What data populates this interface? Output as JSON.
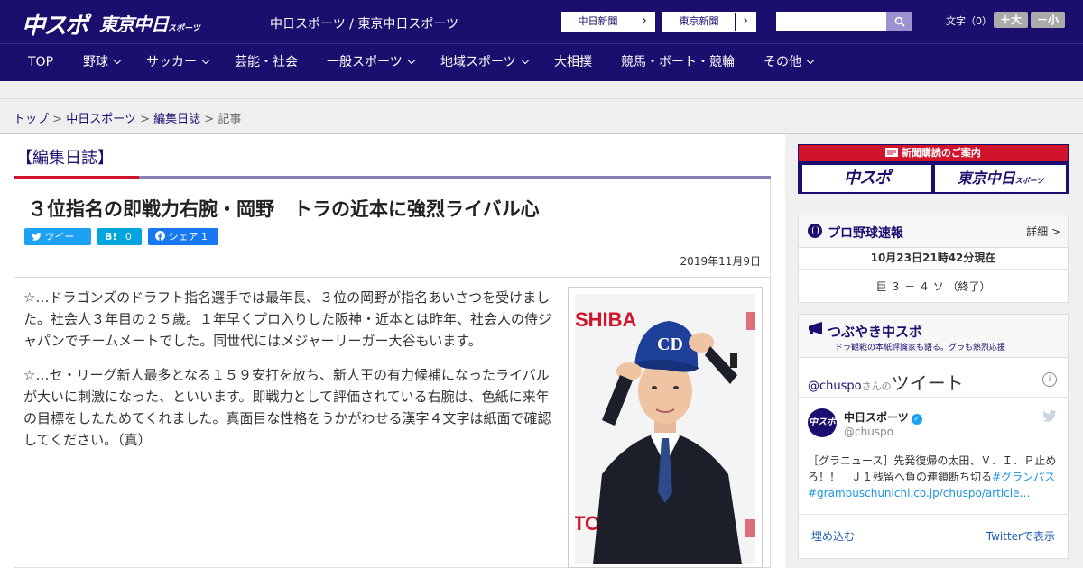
{
  "header": {
    "logo_main": "中スポ",
    "logo_tokyo": "東京中日",
    "logo_tokyo_small": "スポーツ",
    "site_title": "中日スポーツ / 東京中日スポーツ",
    "ext_links": [
      {
        "label": "中日新聞",
        "arrow": "›"
      },
      {
        "label": "東京新聞",
        "arrow": "›"
      }
    ],
    "search_placeholder": "",
    "fontsize_label": "文字（0）",
    "fontsize_up": "＋大",
    "fontsize_down": "－小"
  },
  "nav": {
    "items": [
      {
        "label": "TOP",
        "has_menu": false
      },
      {
        "label": "野球",
        "has_menu": true
      },
      {
        "label": "サッカー",
        "has_menu": true
      },
      {
        "label": "芸能・社会",
        "has_menu": false
      },
      {
        "label": "一般スポーツ",
        "has_menu": true
      },
      {
        "label": "地域スポーツ",
        "has_menu": true
      },
      {
        "label": "大相撲",
        "has_menu": false
      },
      {
        "label": "競馬・ボート・競輪",
        "has_menu": false
      },
      {
        "label": "その他",
        "has_menu": true
      }
    ]
  },
  "breadcrumb": {
    "items": [
      "トップ",
      "中日スポーツ",
      "編集日誌"
    ],
    "current": "記事",
    "separator": ">"
  },
  "article": {
    "section": "【編集日誌】",
    "headline": "３位指名の即戦力右腕・岡野　トラの近本に強烈ライバル心",
    "share": {
      "tweet": "ツイート",
      "hatena_label": "B!",
      "hatena_count": "0",
      "facebook": "シェア",
      "facebook_count": "1"
    },
    "date": "2019年11月9日",
    "paragraphs": [
      "☆…ドラゴンズのドラフト指名選手では最年長、３位の岡野が指名あいさつを受けました。社会人３年目の２５歳。１年早くプロ入りした阪神・近本とは昨年、社会人の侍ジャパンでチームメートでした。同世代にはメジャーリーガー大谷もいます。",
      "☆…セ・リーグ新人最多となる１５９安打を放ち、新人王の有力候補になったライバルが大いに刺激になった、といいます。即戦力として評価されている右腕は、色紙に来年の目標をしたためてくれました。真面目な性格をうかがわせる漢字４文字は紙面で確認してください。（真）"
    ],
    "photo_backdrop_text": "SHIBA",
    "photo_backdrop_text_2": "TOSH",
    "photo_cap_logo": "CD"
  },
  "sidebar": {
    "subscribe": {
      "head": "新聞購読のご案内",
      "banner1": "中スポ",
      "banner2": "東京中日",
      "banner2_small": "スポーツ"
    },
    "baseball": {
      "title": "プロ野球速報",
      "more": "詳細 >",
      "time": "10月23日21時42分現在",
      "score": "巨 ３ － ４ ソ （終了）"
    },
    "twitter": {
      "title": "つぶやき中スポ",
      "subtitle": "ドラ観戦の本紙評論家も語る。グラも熱烈応援",
      "handle": "@chuspo",
      "handle_suffix": "さんの",
      "tweets_label": "ツイート",
      "info": "i",
      "account_name": "中日スポーツ",
      "screen_name": "@chuspo",
      "avatar_text": "中スポ",
      "tweet_text": "［グラニュース］先発復帰の太田、Ｖ．Ｉ．Ｐ止めろ！！　Ｊ１残留へ負の連鎖断ち切る",
      "tweet_hashtag": "#グランパス",
      "tweet_link": "#grampuschunichi.co.jp/chuspo/article…",
      "embed": "埋め込む",
      "view_on": "Twitterで表示"
    }
  },
  "colors": {
    "brand_navy": "#1a0f6e",
    "accent_red": "#d0142c",
    "twitter_blue": "#1da1f2",
    "hatena_blue": "#00a4de",
    "facebook_blue": "#1877f2"
  }
}
